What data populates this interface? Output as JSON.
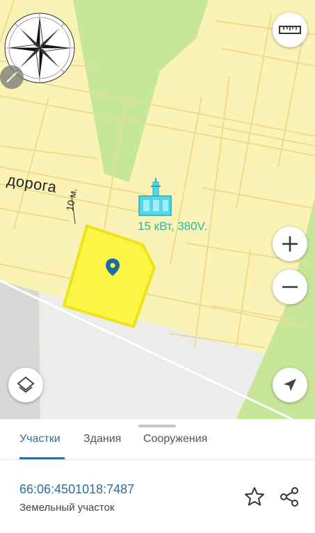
{
  "map": {
    "road_label": "дорога",
    "road_width_label": "10 м.",
    "power_label": "15 кВт, 380V.",
    "colors": {
      "background": "#fbf3b6",
      "forest": "#c6e698",
      "parcel_fill": "#fdf545",
      "parcel_outline": "#eee21a",
      "plot_lines": "#e8de8e",
      "power_label": "#2fb59e",
      "substation": "#53d8e6"
    },
    "controls": {
      "compass": "compass-rose-icon",
      "ruler": "ruler-icon",
      "zoom_in": "plus-icon",
      "zoom_out": "minus-icon",
      "layers": "layers-icon",
      "location": "navigation-arrow-icon"
    }
  },
  "sheet": {
    "tabs": [
      {
        "label": "Участки",
        "active": true
      },
      {
        "label": "Здания",
        "active": false
      },
      {
        "label": "Сооружения",
        "active": false
      }
    ],
    "cadastral_number": "66:06:4501018:7487",
    "parcel_type": "Земельный участок",
    "actions": [
      "star-icon",
      "share-icon"
    ],
    "accent_color": "#2a6f9e"
  }
}
